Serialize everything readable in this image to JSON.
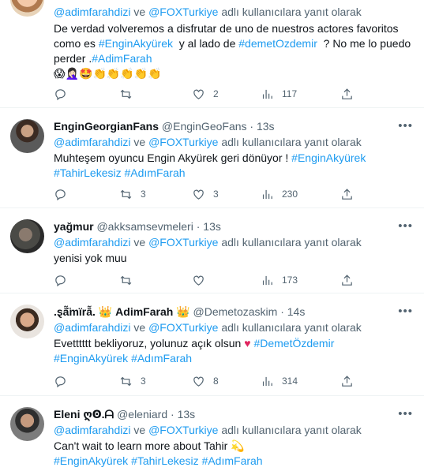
{
  "reply_prefix": "adlı kullanıcılara yanıt olarak",
  "tweets": [
    {
      "reply_to": [
        "@adimfarahdizi",
        "@FOXTurkiye"
      ],
      "joiner": "ve",
      "text_lines": [
        "De verdad volveremos a disfrutar de uno de nuestros actores favoritos",
        "como es",
        "#EnginAkyürek",
        "y al lado de",
        "#demetOzdemir",
        "? No me lo puedo",
        "perder .",
        "#AdimFarah"
      ],
      "emojis": "😱🤦🏻‍♀️🤩👏👏👏👏👏",
      "replies": "",
      "retweets": "",
      "likes": "2",
      "views": "117"
    },
    {
      "name": "EnginGeorgianFans",
      "handle": "@EnginGeoFans",
      "time": "13s",
      "reply_to": [
        "@adimfarahdizi",
        "@FOXTurkiye"
      ],
      "joiner": "ve",
      "text": "Muhteşem oyuncu Engin Akyürek geri dönüyor !",
      "tags": [
        "#EnginAkyürek",
        "#TahirLekesiz",
        "#AdımFarah"
      ],
      "replies": "",
      "retweets": "3",
      "likes": "3",
      "views": "230"
    },
    {
      "name": "yağmur",
      "handle": "@akksamsevmeleri",
      "time": "13s",
      "reply_to": [
        "@adimfarahdizi",
        "@FOXTurkiye"
      ],
      "joiner": "ve",
      "text": "yenisi yok muu",
      "replies": "",
      "retweets": "",
      "likes": "",
      "views": "173"
    },
    {
      "name": ".ȿẫ̈mïrẫ.",
      "name_mid": "AdimFarah",
      "name_crown": "👑",
      "handle": "@Demetozaskim",
      "time": "14s",
      "reply_to": [
        "@adimfarahdizi",
        "@FOXTurkiye"
      ],
      "joiner": "ve",
      "text": "Evetttttt bekliyoruz, yolunuz açık olsun",
      "heart": "♥",
      "tags": [
        "#DemetÖzdemir",
        "#EnginAkyürek",
        "#AdımFarah"
      ],
      "replies": "",
      "retweets": "3",
      "likes": "8",
      "views": "314"
    },
    {
      "name": "Eleni",
      "name_suffix": "ღꙨ.ᗩ",
      "handle": "@eleniard",
      "time": "13s",
      "reply_to": [
        "@adimfarahdizi",
        "@FOXTurkiye"
      ],
      "joiner": "ve",
      "text": "Can't wait to learn more about Tahir",
      "emoji": "💫",
      "tags": [
        "#EnginAkyürek",
        "#TahirLekesiz",
        "#AdımFarah"
      ]
    }
  ],
  "dot": "·",
  "more_icon": "•••",
  "colors": {
    "link": "#1d9bf0",
    "muted": "#536471",
    "text": "#0f1419",
    "heart": "#e0245e"
  }
}
